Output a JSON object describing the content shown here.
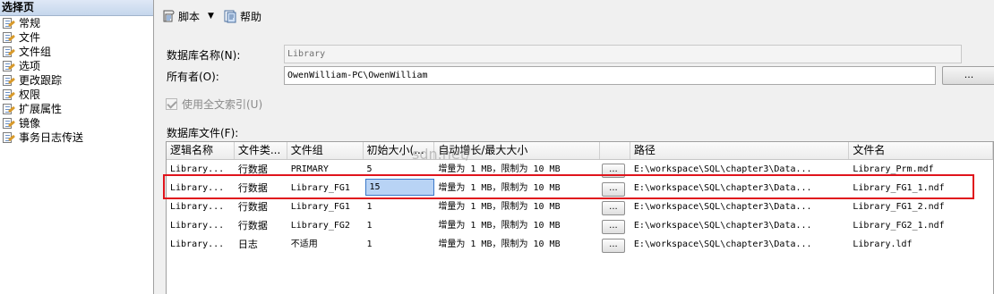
{
  "left_panel": {
    "header": "选择页",
    "items": [
      {
        "label": "常规"
      },
      {
        "label": "文件"
      },
      {
        "label": "文件组"
      },
      {
        "label": "选项"
      },
      {
        "label": "更改跟踪"
      },
      {
        "label": "权限"
      },
      {
        "label": "扩展属性"
      },
      {
        "label": "镜像"
      },
      {
        "label": "事务日志传送"
      }
    ]
  },
  "toolbar": {
    "script_label": "脚本",
    "help_label": "帮助"
  },
  "form": {
    "db_name_label": "数据库名称(N):",
    "db_name_value": "Library",
    "owner_label": "所有者(O):",
    "owner_value": "OwenWilliam-PC\\OwenWilliam",
    "owner_button": "...",
    "fulltext_label": "使用全文索引(U)",
    "files_label": "数据库文件(F):"
  },
  "grid": {
    "columns": [
      "逻辑名称",
      "文件类...",
      "文件组",
      "初始大小(...",
      "自动增长/最大大小",
      "",
      "路径",
      "文件名"
    ],
    "rows": [
      {
        "logical": "Library...",
        "type": "行数据",
        "group": "PRIMARY",
        "size": "5",
        "growth": "增量为 1 MB，限制为 10 MB",
        "btn": "...",
        "path": "E:\\workspace\\SQL\\chapter3\\Data...",
        "file": "Library_Prm.mdf"
      },
      {
        "logical": "Library...",
        "type": "行数据",
        "group": "Library_FG1",
        "size": "15",
        "growth": "增量为 1 MB，限制为 10 MB",
        "btn": "...",
        "path": "E:\\workspace\\SQL\\chapter3\\Data...",
        "file": "Library_FG1_1.ndf"
      },
      {
        "logical": "Library...",
        "type": "行数据",
        "group": "Library_FG1",
        "size": "1",
        "growth": "增量为 1 MB，限制为 10 MB",
        "btn": "...",
        "path": "E:\\workspace\\SQL\\chapter3\\Data...",
        "file": "Library_FG1_2.ndf"
      },
      {
        "logical": "Library...",
        "type": "行数据",
        "group": "Library_FG2",
        "size": "1",
        "growth": "增量为 1 MB，限制为 10 MB",
        "btn": "...",
        "path": "E:\\workspace\\SQL\\chapter3\\Data...",
        "file": "Library_FG2_1.ndf"
      },
      {
        "logical": "Library...",
        "type": "日志",
        "group": "不适用",
        "size": "1",
        "growth": "增量为 1 MB，限制为 10 MB",
        "btn": "...",
        "path": "E:\\workspace\\SQL\\chapter3\\Data...",
        "file": "Library.ldf"
      }
    ]
  },
  "watermark": "sdn.net/",
  "colors": {
    "highlight": "#e0141c",
    "selection": "#b8d3f5"
  }
}
